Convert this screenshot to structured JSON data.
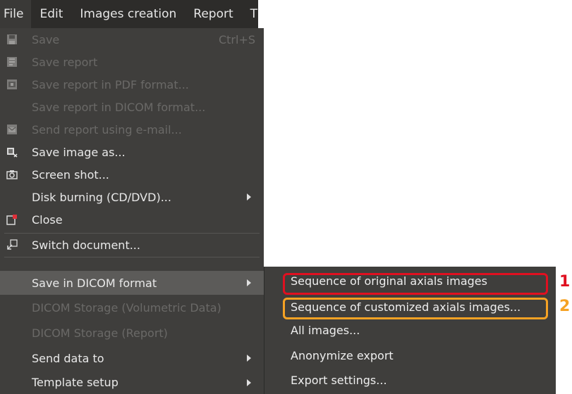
{
  "menubar": {
    "items": [
      "File",
      "Edit",
      "Images creation",
      "Report",
      "T"
    ]
  },
  "file_menu": {
    "items": [
      {
        "label": "Save",
        "shortcut": "Ctrl+S",
        "icon": "floppy-disk-icon",
        "enabled": false
      },
      {
        "label": "Save report",
        "icon": "save-report-icon",
        "enabled": false
      },
      {
        "label": "Save report in PDF format...",
        "icon": "pdf-save-icon",
        "enabled": false
      },
      {
        "label": "Save report in DICOM format...",
        "enabled": false
      },
      {
        "label": "Send report using e-mail...",
        "icon": "email-report-icon",
        "enabled": false
      },
      {
        "label": "Save image as...",
        "icon": "save-image-icon",
        "enabled": true
      },
      {
        "label": "Screen shot...",
        "icon": "camera-icon",
        "enabled": true
      },
      {
        "label": "Disk burning (CD/DVD)...",
        "submenu": true,
        "enabled": true
      },
      {
        "label": "Close",
        "icon": "close-document-icon",
        "enabled": true
      },
      {
        "label": "Switch document...",
        "icon": "switch-document-icon",
        "enabled": true
      },
      {
        "label": "Save in DICOM format",
        "submenu": true,
        "enabled": true,
        "selected": true
      },
      {
        "label": "DICOM Storage (Volumetric Data)",
        "enabled": false
      },
      {
        "label": "DICOM Storage (Report)",
        "enabled": false
      },
      {
        "label": "Send data to",
        "submenu": true,
        "enabled": true
      },
      {
        "label": "Template setup",
        "submenu": true,
        "enabled": true
      }
    ]
  },
  "dicom_submenu": {
    "items": [
      "Sequence of original axials images",
      "Sequence of customized axials images...",
      "All images...",
      "Anonymize export",
      "Export settings..."
    ]
  },
  "callouts": [
    "1",
    "2"
  ],
  "colors": {
    "menu_bg": "#3f3e3c",
    "menubar_bg": "#2d2c2a",
    "selected_bg": "#5c5b59",
    "highlight_red": "#e01020",
    "highlight_orange": "#f5a224"
  }
}
